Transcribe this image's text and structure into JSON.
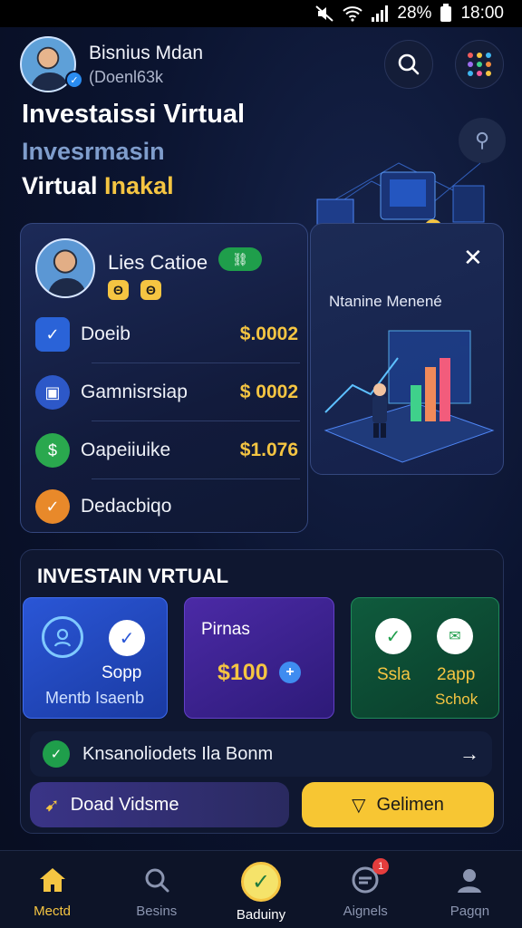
{
  "status_bar": {
    "battery_text": "28%",
    "time": "18:00"
  },
  "profile": {
    "name": "Bisnius Mdan",
    "handle": "(Doenl63k"
  },
  "header": {
    "title": "Investaissi Virtual",
    "subtitle_1": "Invesrmasin",
    "subtitle_2_white": "Virtual ",
    "subtitle_2_gold": "Inakal"
  },
  "stats_card": {
    "name": "Lies Catioe",
    "badge_chip_1": "Θ",
    "badge_chip_2": "Θ",
    "rows": [
      {
        "label": "Doeib",
        "value": "$.0002"
      },
      {
        "label": "Gamnisrsiap",
        "value": "$ 0002"
      },
      {
        "label": "Oapeiiuike",
        "value": "$1.076"
      },
      {
        "label": "Dedacbiqo",
        "value": ""
      }
    ]
  },
  "illustration_card": {
    "title": "Ntanine Menené"
  },
  "invest_section": {
    "title": "INVESTAIN VRTUAL",
    "tile_1": {
      "label": "Sopp",
      "sublabel": "Mentb Isaenb"
    },
    "tile_2": {
      "label": "Pirnas",
      "amount": "$100"
    },
    "tile_3": {
      "label_left": "Ssla",
      "label_right": "2app",
      "sublabel": "Schok"
    },
    "info_row_label": "Knsanoliodets Ila Bonm",
    "btn_left_label": "Doad Vidsme",
    "btn_right_label": "Gelimen"
  },
  "bottom_nav": [
    {
      "label": "Mectd"
    },
    {
      "label": "Besins"
    },
    {
      "label": "Baduiny"
    },
    {
      "label": "Aignels",
      "badge": "1"
    },
    {
      "label": "Pagqn"
    }
  ],
  "colors": {
    "accent_gold": "#f5c542",
    "green": "#1f9e4b",
    "blue": "#2a56d6",
    "purple": "#4b2aa6"
  }
}
